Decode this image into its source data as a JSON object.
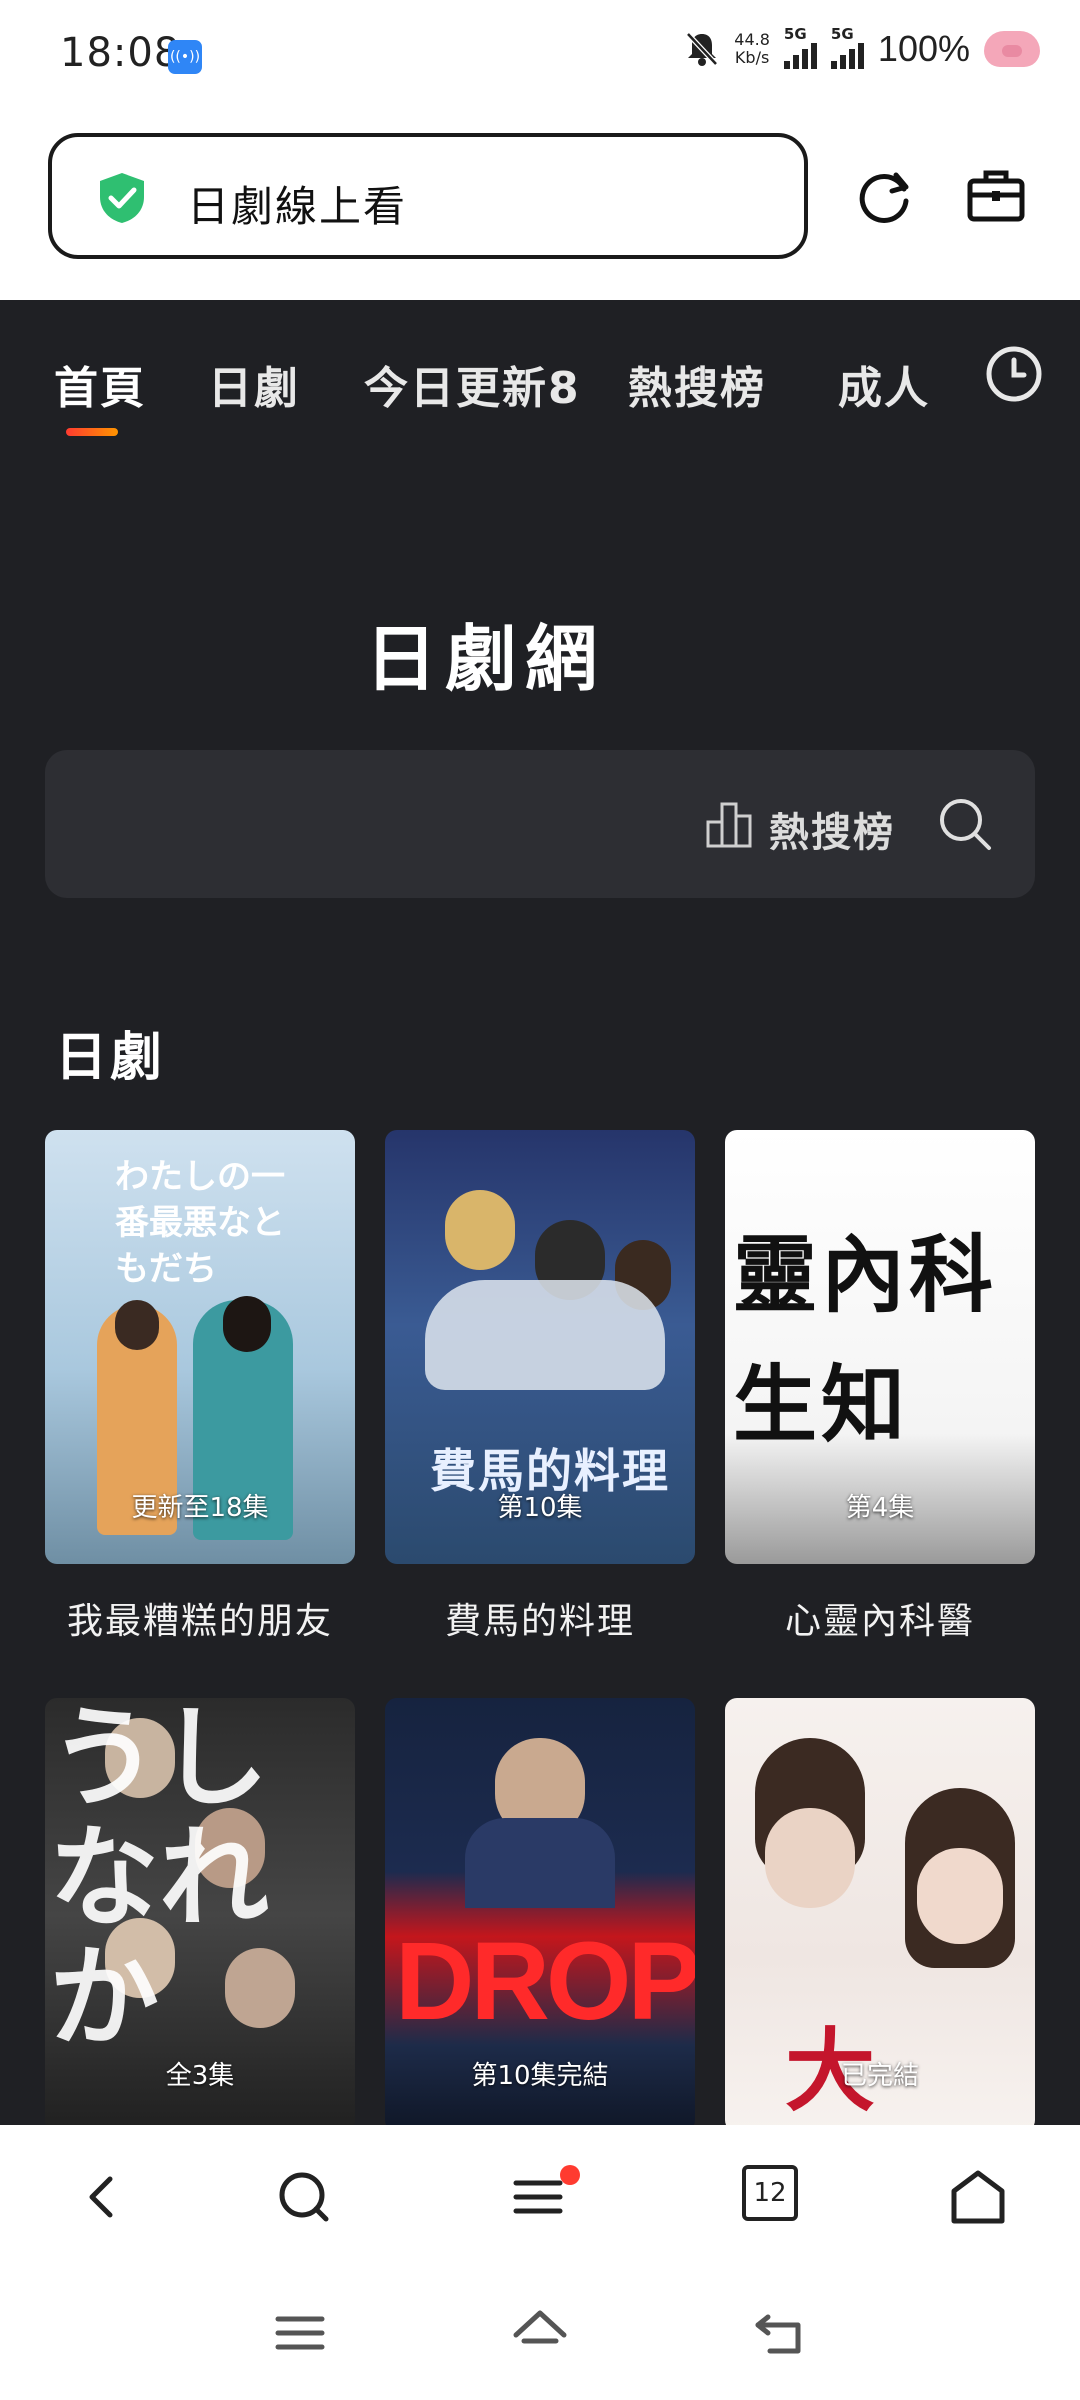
{
  "status_bar": {
    "time": "18:08",
    "hotspot_badge": "((•))",
    "net_speed_value": "44.8",
    "net_speed_unit": "Kb/s",
    "sig1_label": "5G",
    "sig2_label": "5G",
    "battery": "100%"
  },
  "address_bar": {
    "text": "日劇線上看"
  },
  "tabs": [
    {
      "label": "首頁",
      "active": true
    },
    {
      "label": "日劇",
      "active": false
    },
    {
      "label": "今日更新8",
      "active": false
    },
    {
      "label": "熱搜榜",
      "active": false
    },
    {
      "label": "成人",
      "active": false
    }
  ],
  "site": {
    "title": "日劇網"
  },
  "search": {
    "hot_rank_label": "熱搜榜"
  },
  "section": {
    "title": "日劇"
  },
  "dramas": [
    {
      "title": "我最糟糕的朋友",
      "episode": "更新至18集",
      "poster_text": "わたしの一番最悪なともだち"
    },
    {
      "title": "費馬的料理",
      "episode": "第10集",
      "poster_text": "費馬的料理"
    },
    {
      "title": "心靈內科醫",
      "episode": "第4集",
      "poster_text": "靈內科 生知"
    },
    {
      "title": "",
      "episode": "全3集",
      "poster_text": "うしなれか"
    },
    {
      "title": "",
      "episode": "第10集完結",
      "poster_text": "DROP"
    },
    {
      "title": "",
      "episode": "已完結",
      "poster_text": "大 夫"
    }
  ],
  "colors": {
    "content_bg": "#1f2024",
    "search_bg": "#2d2e33",
    "accent_gradient_start": "#ff3b30",
    "accent_gradient_end": "#ff9500",
    "shield": "#2fbf71"
  },
  "bottom_bar": {
    "tabs_count": "12"
  }
}
